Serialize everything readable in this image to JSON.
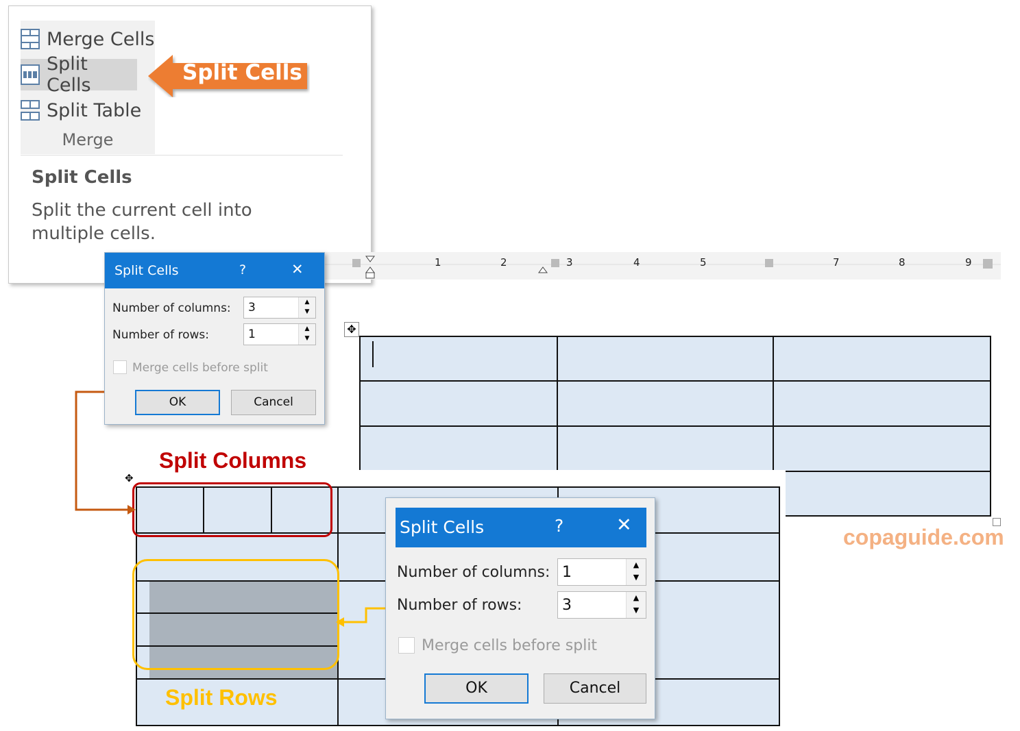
{
  "ribbon": {
    "items": [
      {
        "label": "Merge Cells",
        "icon": "merge-cells-icon"
      },
      {
        "label": "Split Cells",
        "icon": "split-cells-icon"
      },
      {
        "label": "Split Table",
        "icon": "split-table-icon"
      }
    ],
    "group_label": "Merge",
    "tooltip": {
      "title": "Split Cells",
      "description": "Split the current cell into multiple cells."
    }
  },
  "callout": {
    "text": "Split Cells",
    "color": "#ed7d31"
  },
  "ruler": {
    "numbers": [
      "1",
      "2",
      "3",
      "4",
      "5",
      "7",
      "8",
      "9"
    ]
  },
  "dialog_small": {
    "title": "Split Cells",
    "help": "?",
    "close": "✕",
    "columns_label": "Number of columns:",
    "columns_value": "3",
    "rows_label": "Number of rows:",
    "rows_value": "1",
    "merge_label": "Merge cells before split",
    "ok": "OK",
    "cancel": "Cancel"
  },
  "dialog_large": {
    "title": "Split Cells",
    "help": "?",
    "close": "✕",
    "columns_label": "Number of columns:",
    "columns_value": "1",
    "rows_label": "Number of rows:",
    "rows_value": "3",
    "merge_label": "Merge cells before split",
    "ok": "OK",
    "cancel": "Cancel"
  },
  "annotations": {
    "split_columns": "Split Columns",
    "split_rows": "Split Rows",
    "watermark": "copaguide.com"
  },
  "colors": {
    "title_bar": "#1479d4",
    "cell_fill": "#dde8f4",
    "split_columns": "#c00000",
    "split_rows": "#ffc000",
    "arrow": "#c55a11",
    "watermark": "#f4b183"
  }
}
